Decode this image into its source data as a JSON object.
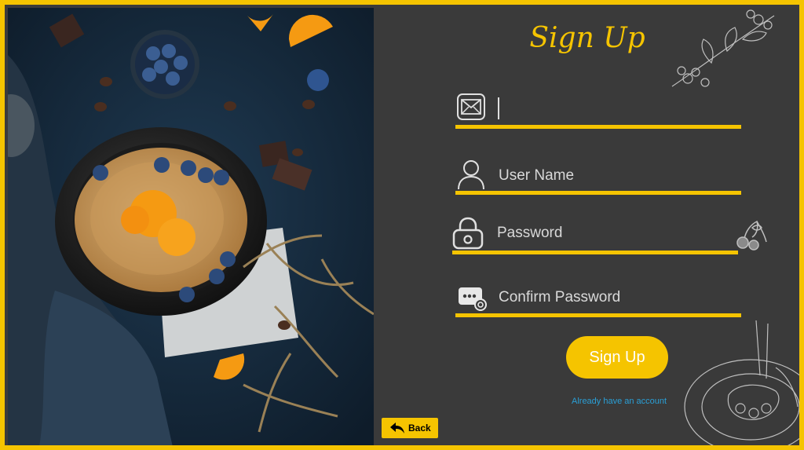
{
  "form": {
    "title": "Sign Up",
    "email": {
      "value": "",
      "placeholder": ""
    },
    "username": {
      "placeholder": "User Name"
    },
    "password": {
      "placeholder": "Password"
    },
    "confirm": {
      "placeholder": "Confirm Password"
    },
    "signup_label": "Sign Up",
    "login_link": "Already have an account"
  },
  "footer": {
    "back_label": "Back"
  },
  "colors": {
    "accent": "#f5c400",
    "panel": "#3a3a3a",
    "link": "#2a9fd6"
  },
  "icons": [
    "envelope-icon",
    "user-icon",
    "lock-icon",
    "id-card-icon",
    "back-arrow-icon",
    "herb-sketch-icon",
    "cherry-sketch-icon",
    "plate-sketch-icon"
  ]
}
